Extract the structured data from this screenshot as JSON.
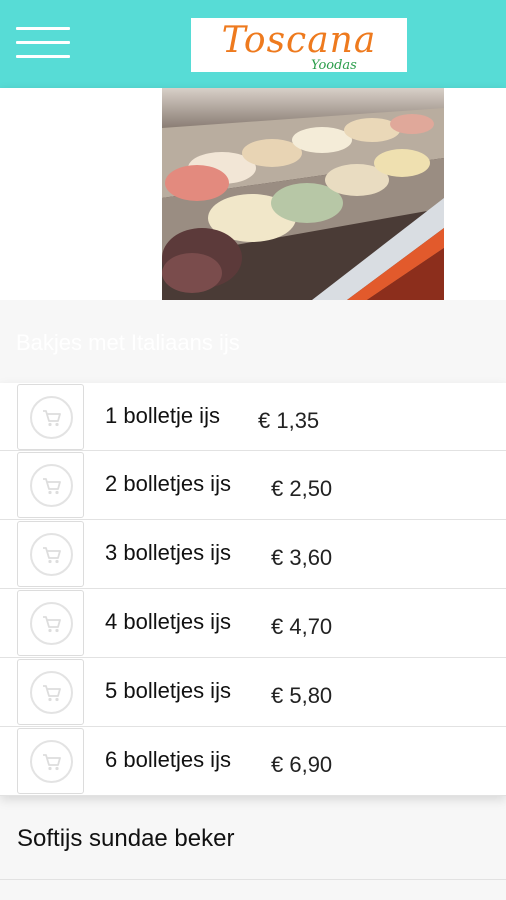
{
  "header": {
    "menu_icon": "hamburger-menu-icon",
    "logo": {
      "name": "Toscana",
      "sub": "Yoodas"
    },
    "background_color": "#57dcd6"
  },
  "section": {
    "title": "Bakjes met Italiaans ijs"
  },
  "items": [
    {
      "label": "1 bolletje ijs",
      "price": "€ 1,35"
    },
    {
      "label": "2 bolletjes ijs",
      "price": "€ 2,50"
    },
    {
      "label": "3 bolletjes ijs",
      "price": "€ 3,60"
    },
    {
      "label": "4 bolletjes ijs",
      "price": "€ 4,70"
    },
    {
      "label": "5 bolletjes ijs",
      "price": "€ 5,80"
    },
    {
      "label": "6 bolletjes ijs",
      "price": "€ 6,90"
    }
  ],
  "cart_icon": "shopping-cart-icon",
  "next_section": {
    "label": "Softijs sundae beker"
  }
}
